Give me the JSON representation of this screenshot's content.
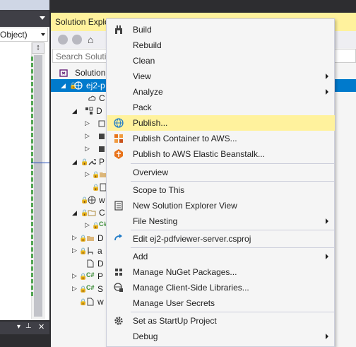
{
  "editor": {
    "combo_text": "Object)",
    "split_glyph": "↕"
  },
  "solution_explorer": {
    "title": "Solution Explo",
    "search_placeholder": "Search Solutio",
    "tree": [
      {
        "label": "Solution",
        "icon": "solution-icon"
      },
      {
        "label": "ej2-p",
        "icon": "web-project-icon",
        "selected": true
      },
      {
        "label": "C",
        "icon": "connected-services-icon"
      },
      {
        "label": "D",
        "icon": "dependencies-icon"
      },
      {
        "label": "P",
        "icon": "properties-wrench-icon"
      },
      {
        "label": "w",
        "icon": "globe-icon"
      },
      {
        "label": "C",
        "icon": "folder-icon"
      },
      {
        "label": "D",
        "icon": "folder-icon"
      },
      {
        "label": "a",
        "icon": "json-file-icon"
      },
      {
        "label": "D",
        "icon": "file-icon"
      },
      {
        "label": "P",
        "icon": "csharp-file-icon"
      },
      {
        "label": "S",
        "icon": "csharp-file-icon"
      },
      {
        "label": "w",
        "icon": "config-file-icon"
      }
    ]
  },
  "context_menu": {
    "items": [
      {
        "label": "Build",
        "icon": "build-icon"
      },
      {
        "label": "Rebuild"
      },
      {
        "label": "Clean"
      },
      {
        "label": "View",
        "submenu": true
      },
      {
        "label": "Analyze",
        "submenu": true
      },
      {
        "label": "Pack"
      },
      {
        "label": "Publish...",
        "icon": "publish-globe-icon",
        "highlighted": true
      },
      {
        "label": "Publish Container to AWS...",
        "icon": "aws-container-icon"
      },
      {
        "label": "Publish to AWS Elastic Beanstalk...",
        "icon": "aws-beanstalk-icon"
      },
      {
        "label": "Overview"
      },
      {
        "label": "Scope to This"
      },
      {
        "label": "New Solution Explorer View",
        "icon": "new-view-icon"
      },
      {
        "label": "File Nesting",
        "submenu": true
      },
      {
        "label": "Edit ej2-pdfviewer-server.csproj",
        "icon": "edit-arrow-icon"
      },
      {
        "label": "Add",
        "submenu": true
      },
      {
        "label": "Manage NuGet Packages...",
        "icon": "nuget-icon"
      },
      {
        "label": "Manage Client-Side Libraries...",
        "icon": "client-libraries-icon"
      },
      {
        "label": "Manage User Secrets"
      },
      {
        "label": "Set as StartUp Project",
        "icon": "gear-icon"
      },
      {
        "label": "Debug",
        "submenu": true
      }
    ]
  },
  "colors": {
    "highlight": "#fff29d",
    "selection": "#007acc",
    "menu_bg": "#f5f5f5"
  }
}
